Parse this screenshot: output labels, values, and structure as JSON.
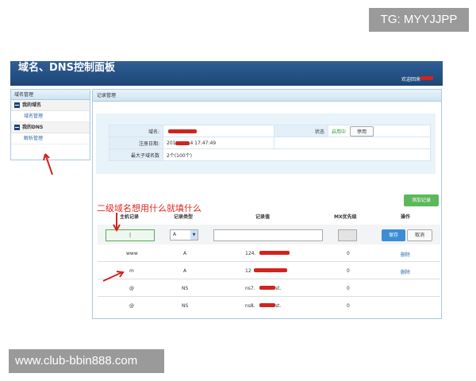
{
  "watermark_top": "TG: MYYJJPP",
  "watermark_bottom": "www.club-bbin888.com",
  "header": {
    "title": "域名、DNS控制面板",
    "welcome": "欢迎回来"
  },
  "sidebar": {
    "title": "域名管理",
    "groups": [
      {
        "label": "我的域名",
        "item": "域名管理"
      },
      {
        "label": "我的DNS",
        "item": "解析管理"
      }
    ]
  },
  "main": {
    "title": "记录管理",
    "info": {
      "domain_label": "域名:",
      "status_label": "状态",
      "status_value": "启用中",
      "disable_button": "停用",
      "reg_date_label": "注册日期:",
      "reg_date_value": "201",
      "reg_time_value": "4 17:47:49",
      "max_sub_label": "最大子域名数",
      "max_sub_value": "2个(100个)"
    },
    "add_button": "添加记录",
    "annotation": "二级域名想用什么就填什么",
    "columns": [
      "主机记录",
      "记录类型",
      "记录值",
      "MX优先级",
      "操作"
    ],
    "edit_row": {
      "host_value": "|",
      "type_value": "A",
      "save": "保存",
      "cancel": "取消"
    },
    "rows": [
      {
        "host": "www",
        "type": "A",
        "value": "124.",
        "mx": "0",
        "action": "删除"
      },
      {
        "host": "m",
        "type": "A",
        "value": "12",
        "mx": "0",
        "action": "删除"
      },
      {
        "host": "@",
        "type": "NS",
        "value": "ns7.",
        "value_tail": "st.",
        "mx": "0",
        "action": ""
      },
      {
        "host": "@",
        "type": "NS",
        "value": "ns8.",
        "value_tail": "st.",
        "mx": "0",
        "action": ""
      }
    ]
  },
  "colors": {
    "header_bg": "#1d4677",
    "accent_green": "#5cb85c",
    "save_blue": "#3b8ed4",
    "annotation_red": "#e0261d"
  }
}
